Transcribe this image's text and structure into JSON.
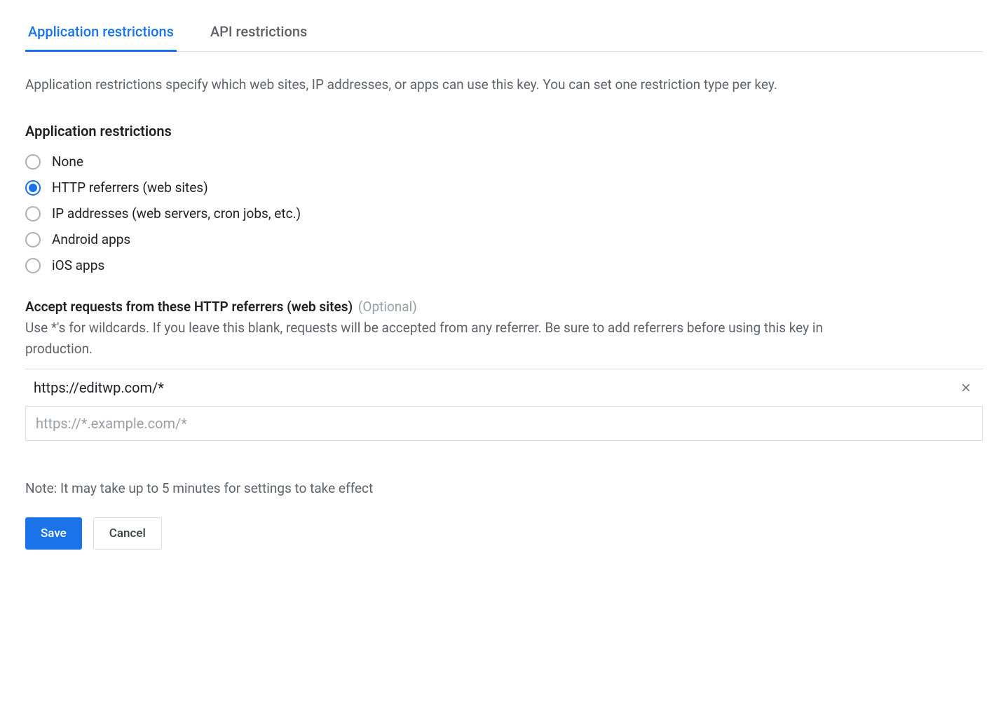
{
  "tabs": {
    "application": "Application restrictions",
    "api": "API restrictions"
  },
  "description": "Application restrictions specify which web sites, IP addresses, or apps can use this key. You can set one restriction type per key.",
  "section_heading": "Application restrictions",
  "radios": {
    "none": "None",
    "http_referrers": "HTTP referrers (web sites)",
    "ip_addresses": "IP addresses (web servers, cron jobs, etc.)",
    "android_apps": "Android apps",
    "ios_apps": "iOS apps"
  },
  "referrers": {
    "heading": "Accept requests from these HTTP referrers (web sites)",
    "optional": "(Optional)",
    "help": "Use *'s for wildcards. If you leave this blank, requests will be accepted from any referrer. Be sure to add referrers before using this key in production.",
    "items": [
      "https://editwp.com/*"
    ],
    "placeholder": "https://*.example.com/*"
  },
  "note": "Note: It may take up to 5 minutes for settings to take effect",
  "buttons": {
    "save": "Save",
    "cancel": "Cancel"
  }
}
